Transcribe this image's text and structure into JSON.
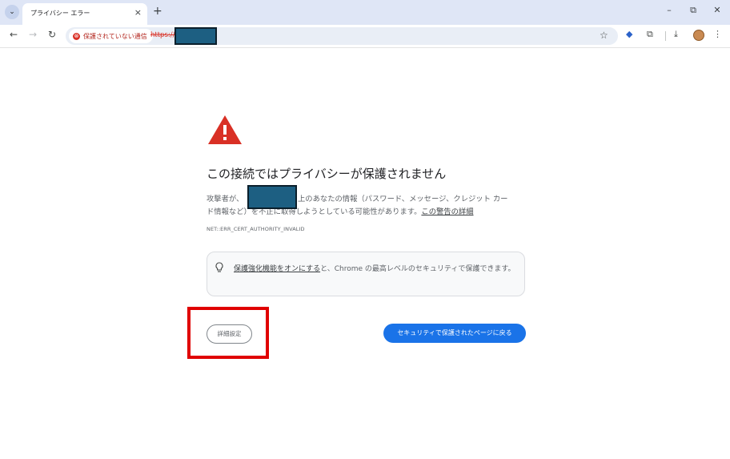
{
  "browser": {
    "tab": {
      "title": "プライバシー エラー",
      "close_glyph": "×"
    },
    "tab_menu_glyph": "⌄",
    "new_tab_glyph": "+",
    "window": {
      "minimize": "–",
      "maximize": "⧉",
      "close": "✕"
    },
    "toolbar": {
      "back": "←",
      "forward": "→",
      "reload": "↻",
      "security_chip_label": "保護されていない通信",
      "security_chip_icon": "⊗",
      "url_scheme": "https://",
      "bookmark_glyph": "☆",
      "extension_glyph": "◆",
      "puzzle_glyph": "⧉",
      "download_glyph": "⤓",
      "menu_glyph": "⋮"
    }
  },
  "interstitial": {
    "heading": "この接続ではプライバシーが保護されません",
    "body_line1_prefix": "攻撃者が、",
    "body_line1_suffix": "上のあなたの情報（パスワード、メッセージ、クレジット カー",
    "body_line2_prefix": "ド情報など）を不正に取得しようとしている可能性があります。",
    "details_link": "この警告の詳細",
    "error_code": "NET::ERR_CERT_AUTHORITY_INVALID",
    "promo": {
      "link_text": "保護強化機能をオンにする",
      "text": "と、Chrome の最高レベルのセキュリティで保護できます。"
    },
    "advanced_button": "詳細設定",
    "back_button": "セキュリティで保護されたページに戻る"
  },
  "colors": {
    "warning_red": "#d93025",
    "primary_blue": "#1a73e8",
    "redaction": "#1d5f82",
    "highlight_box": "#e00000"
  }
}
